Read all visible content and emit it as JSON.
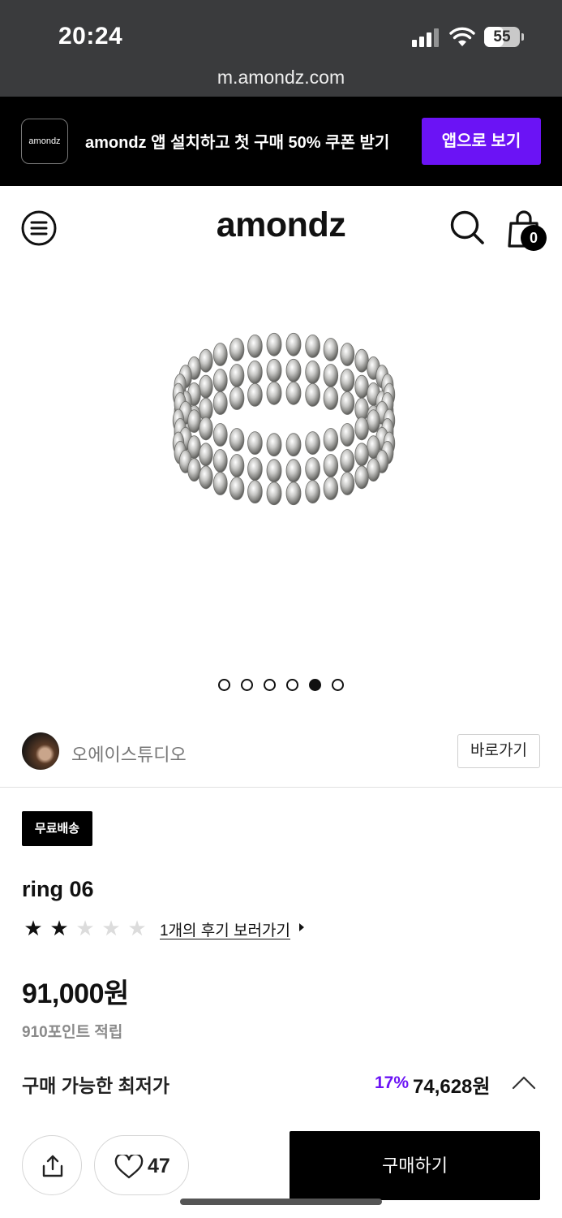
{
  "status_bar": {
    "time": "20:24",
    "battery": "55",
    "battery_fraction": 0.55,
    "url": "m.amondz.com"
  },
  "promo": {
    "logo": "amondz",
    "text": "amondz 앱 설치하고 첫 구매 50% 쿠폰 받기",
    "button": "앱으로 보기",
    "accent_color": "#6b13f5"
  },
  "header": {
    "brand": "amondz",
    "cart_count": "0",
    "icons": [
      "menu-icon",
      "search-icon",
      "shopping-bag-icon"
    ]
  },
  "gallery": {
    "image": "silver beaded ring",
    "dot_count": 6,
    "active_index": 4
  },
  "shop": {
    "name": "오에이스튜디오",
    "go_button": "바로가기"
  },
  "product": {
    "badge": "무료배송",
    "name": "ring 06",
    "rating": 2,
    "rating_max": 5,
    "review_link": "1개의 후기 보러가기",
    "price": "91,000원",
    "points": "910포인트 적립"
  },
  "lowest": {
    "label": "구매 가능한 최저가",
    "discount": "17%",
    "price": "74,628원"
  },
  "bottom_bar": {
    "likes": "47",
    "buy_button": "구매하기"
  }
}
